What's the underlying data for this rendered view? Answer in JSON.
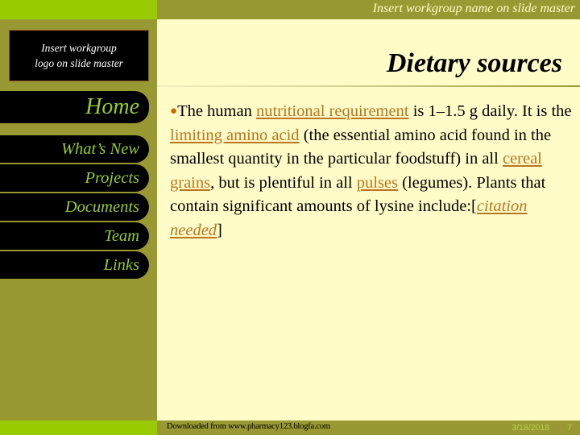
{
  "header": {
    "workgroup_name": "Insert workgroup name on slide master",
    "logo_placeholder_line1": "Insert workgroup",
    "logo_placeholder_line2": "logo on slide master"
  },
  "nav": {
    "items": [
      {
        "label": "Home"
      },
      {
        "label": "What’s New"
      },
      {
        "label": "Projects"
      },
      {
        "label": "Documents"
      },
      {
        "label": "Team"
      },
      {
        "label": "Links"
      }
    ]
  },
  "slide": {
    "title": "Dietary sources",
    "bullet_icon": "bullet-dot-icon",
    "body": {
      "t1": "The human ",
      "l1": "nutritional requirement",
      "t2": " is 1–1.5 g daily. It is the ",
      "l2": "limiting amino acid",
      "t3": " (the essential amino acid found in the smallest quantity in the particular foodstuff) in all ",
      "l3": "cereal grains",
      "t4": ", but is plentiful in all ",
      "l4": "pulses",
      "t5": " (legumes). Plants that contain significant amounts of lysine include:[",
      "l5": "citation needed",
      "t6": "]"
    }
  },
  "footer": {
    "source": "Downloaded from www.pharmacy123.blogfa.com",
    "date": "3/18/2018",
    "page_number": "7"
  },
  "colors": {
    "olive": "#999933",
    "lime": "#99cc00",
    "cream": "#fffcc8",
    "link": "#b87522",
    "nav_text": "#99cc33",
    "bullet": "#cc6600"
  }
}
